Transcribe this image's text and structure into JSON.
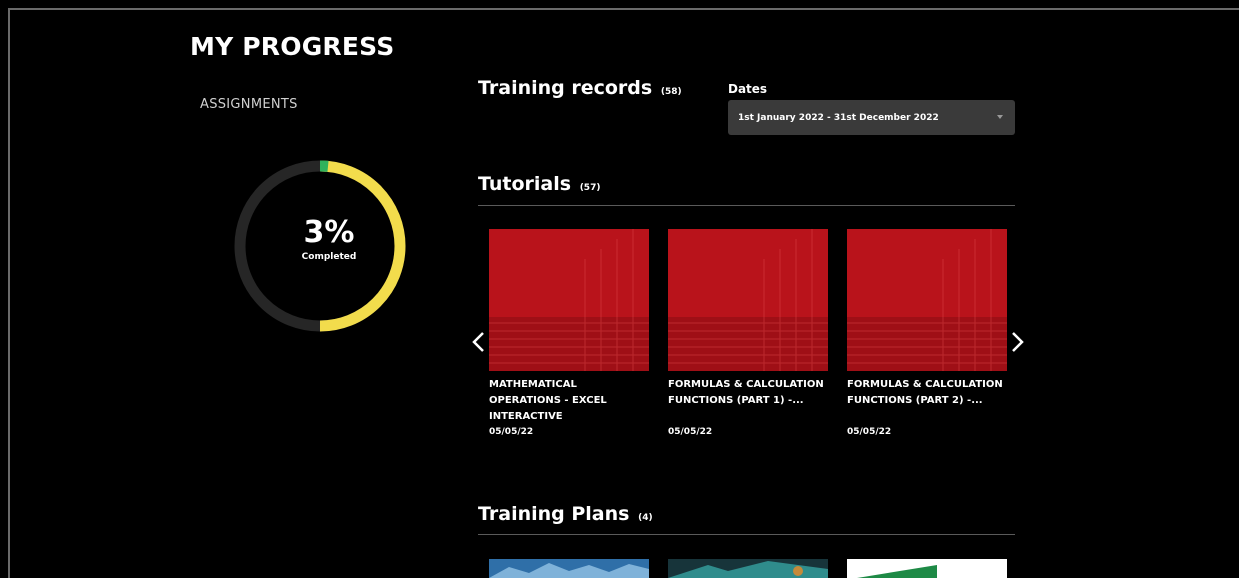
{
  "page": {
    "title": "MY PROGRESS"
  },
  "assignments": {
    "label": "ASSIGNMENTS",
    "percent_text": "3%",
    "percent_value": 0.03,
    "sub": "Completed",
    "colors": {
      "track": "#262626",
      "progress": "#f2dc4c",
      "marker": "#31b25c"
    }
  },
  "training_records": {
    "title": "Training records",
    "count": "(58)"
  },
  "dates": {
    "label": "Dates",
    "selected": "1st January 2022 - 31st December 2022"
  },
  "tutorials": {
    "title": "Tutorials",
    "count": "(57)",
    "items": [
      {
        "title": "MATHEMATICAL OPERATIONS - EXCEL INTERACTIVE",
        "date": "05/05/22"
      },
      {
        "title": "FORMULAS & CALCULATION FUNCTIONS (PART 1) -...",
        "date": "05/05/22"
      },
      {
        "title": "FORMULAS & CALCULATION FUNCTIONS (PART 2) -...",
        "date": "05/05/22"
      }
    ],
    "prev_icon": "chevron-left-icon",
    "next_icon": "chevron-right-icon"
  },
  "training_plans": {
    "title": "Training Plans",
    "count": "(4)"
  }
}
